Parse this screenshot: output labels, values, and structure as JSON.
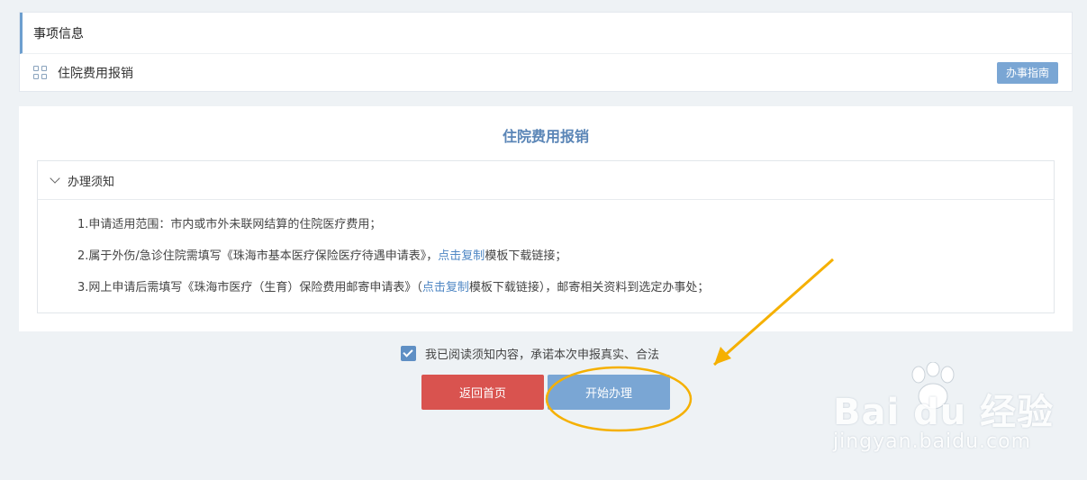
{
  "top_card": {
    "header": "事项信息",
    "item_name": "住院费用报销",
    "guide_button": "办事指南"
  },
  "main": {
    "title": "住院费用报销",
    "notice_header": "办理须知",
    "items": [
      {
        "pre": "1.申请适用范围：市内或市外未联网结算的住院医疗费用；",
        "link": "",
        "post": ""
      },
      {
        "pre": "2.属于外伤/急诊住院需填写《珠海市基本医疗保险医疗待遇申请表》，",
        "link": "点击复制",
        "post": "模板下载链接；"
      },
      {
        "pre": "3.网上申请后需填写《珠海市医疗（生育）保险费用邮寄申请表》（",
        "link": "点击复制",
        "post": "模板下载链接），邮寄相关资料到选定办事处；"
      }
    ]
  },
  "agreement": {
    "checked": true,
    "text": "我已阅读须知内容，承诺本次申报真实、合法"
  },
  "buttons": {
    "back": "返回首页",
    "start": "开始办理"
  },
  "watermark": {
    "brand": "Bai du 经验",
    "url": "jingyan.baidu.com"
  },
  "colors": {
    "accent": "#7aa6d4",
    "danger": "#d9534f",
    "link": "#4f87c4",
    "annotation": "#f5b000"
  }
}
